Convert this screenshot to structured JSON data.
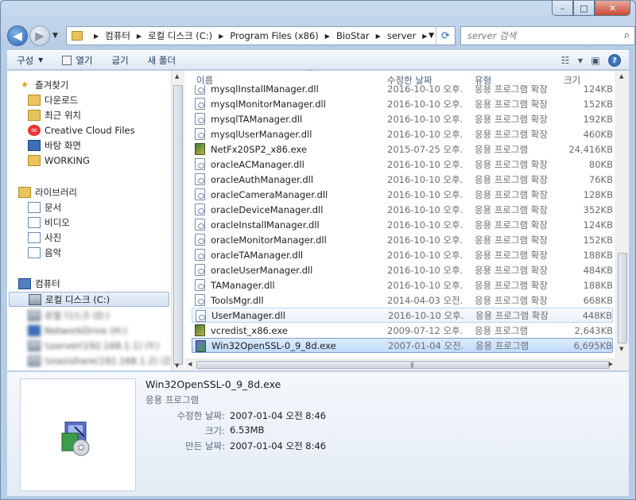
{
  "window": {
    "caption_buttons": {
      "minimize": "–",
      "maximize": "□",
      "close": "✕"
    }
  },
  "nav": {
    "back_icon": "back-arrow-icon",
    "forward_icon": "forward-arrow-icon",
    "breadcrumb": [
      "컴퓨터",
      "로컬 디스크 (C:)",
      "Program Files (x86)",
      "BioStar",
      "server"
    ],
    "search_placeholder": "server 검색"
  },
  "toolbar": {
    "organize": "구성",
    "open": "열기",
    "burn": "굽기",
    "new_folder": "새 폴더"
  },
  "sidebar": {
    "favorites_header": "즐겨찾기",
    "favorites": [
      "다운로드",
      "최근 위치",
      "Creative Cloud Files",
      "바탕 화면",
      "WORKING"
    ],
    "libraries_header": "라이브러리",
    "libraries": [
      "문서",
      "비디오",
      "사진",
      "음악"
    ],
    "computer_header": "컴퓨터",
    "drives": [
      "로컬 디스크 (C:)",
      "로컬 디스크 (D:)",
      "NetworkDrive (H:)",
      "\\\\server(192.168.1.1) (Y:)",
      "\\\\nas\\share(192.168.1.2) (Z:)"
    ]
  },
  "columns": {
    "name": "이름",
    "date": "수정한 날짜",
    "type": "유형",
    "size": "크기"
  },
  "files": [
    {
      "name": "mysqlInstallManager.dll",
      "date": "2016-10-10 오후...",
      "type": "응용 프로그램 확장",
      "size": "124KB",
      "kind": "dll"
    },
    {
      "name": "mysqlMonitorManager.dll",
      "date": "2016-10-10 오후...",
      "type": "응용 프로그램 확장",
      "size": "152KB",
      "kind": "dll"
    },
    {
      "name": "mysqlTAManager.dll",
      "date": "2016-10-10 오후...",
      "type": "응용 프로그램 확장",
      "size": "192KB",
      "kind": "dll"
    },
    {
      "name": "mysqlUserManager.dll",
      "date": "2016-10-10 오후...",
      "type": "응용 프로그램 확장",
      "size": "460KB",
      "kind": "dll"
    },
    {
      "name": "NetFx20SP2_x86.exe",
      "date": "2015-07-25 오후...",
      "type": "응용 프로그램",
      "size": "24,416KB",
      "kind": "exe"
    },
    {
      "name": "oracleACManager.dll",
      "date": "2016-10-10 오후...",
      "type": "응용 프로그램 확장",
      "size": "80KB",
      "kind": "dll"
    },
    {
      "name": "oracleAuthManager.dll",
      "date": "2016-10-10 오후...",
      "type": "응용 프로그램 확장",
      "size": "76KB",
      "kind": "dll"
    },
    {
      "name": "oracleCameraManager.dll",
      "date": "2016-10-10 오후...",
      "type": "응용 프로그램 확장",
      "size": "128KB",
      "kind": "dll"
    },
    {
      "name": "oracleDeviceManager.dll",
      "date": "2016-10-10 오후...",
      "type": "응용 프로그램 확장",
      "size": "352KB",
      "kind": "dll"
    },
    {
      "name": "oracleInstallManager.dll",
      "date": "2016-10-10 오후...",
      "type": "응용 프로그램 확장",
      "size": "124KB",
      "kind": "dll"
    },
    {
      "name": "oracleMonitorManager.dll",
      "date": "2016-10-10 오후...",
      "type": "응용 프로그램 확장",
      "size": "152KB",
      "kind": "dll"
    },
    {
      "name": "oracleTAManager.dll",
      "date": "2016-10-10 오후...",
      "type": "응용 프로그램 확장",
      "size": "188KB",
      "kind": "dll"
    },
    {
      "name": "oracleUserManager.dll",
      "date": "2016-10-10 오후...",
      "type": "응용 프로그램 확장",
      "size": "484KB",
      "kind": "dll"
    },
    {
      "name": "TAManager.dll",
      "date": "2016-10-10 오후...",
      "type": "응용 프로그램 확장",
      "size": "188KB",
      "kind": "dll"
    },
    {
      "name": "ToolsMgr.dll",
      "date": "2014-04-03 오전...",
      "type": "응용 프로그램 확장",
      "size": "668KB",
      "kind": "dll"
    },
    {
      "name": "UserManager.dll",
      "date": "2016-10-10 오후...",
      "type": "응용 프로그램 확장",
      "size": "448KB",
      "kind": "dll"
    },
    {
      "name": "vcredist_x86.exe",
      "date": "2009-07-12 오후...",
      "type": "응용 프로그램",
      "size": "2,643KB",
      "kind": "exe"
    },
    {
      "name": "Win32OpenSSL-0_9_8d.exe",
      "date": "2007-01-04 오전...",
      "type": "응용 프로그램",
      "size": "6,695KB",
      "kind": "setup"
    }
  ],
  "details": {
    "name": "Win32OpenSSL-0_9_8d.exe",
    "type": "응용 프로그램",
    "modified_label": "수정한 날짜:",
    "modified_value": "2007-01-04 오전 8:46",
    "size_label": "크기:",
    "size_value": "6.53MB",
    "created_label": "만든 날짜:",
    "created_value": "2007-01-04 오전 8:46"
  }
}
